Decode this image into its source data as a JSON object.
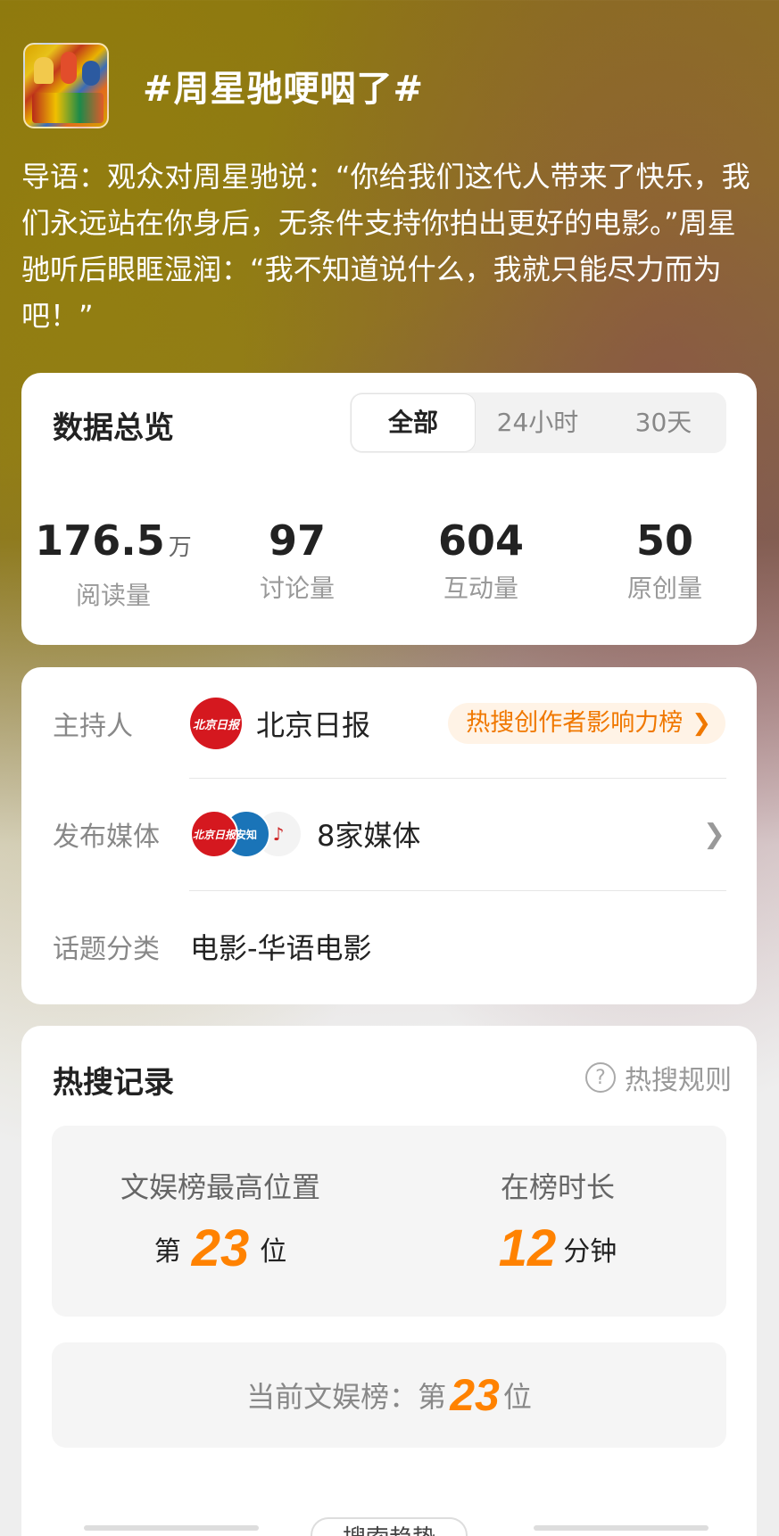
{
  "topic": {
    "title": "#周星驰哽咽了#",
    "intro": "导语：观众对周星驰说：“你给我们这代人带来了快乐，我们永远站在你身后，无条件支持你拍出更好的电影。”周星驰听后眼眶湿润：“我不知道说什么，我就只能尽力而为吧！”"
  },
  "overview": {
    "title": "数据总览",
    "tabs": [
      "全部",
      "24小时",
      "30天"
    ],
    "stats": [
      {
        "value": "176.5",
        "unit": "万",
        "label": "阅读量"
      },
      {
        "value": "97",
        "unit": "",
        "label": "讨论量"
      },
      {
        "value": "604",
        "unit": "",
        "label": "互动量"
      },
      {
        "value": "50",
        "unit": "",
        "label": "原创量"
      }
    ]
  },
  "host": {
    "host_label": "主持人",
    "host_name": "北京日报",
    "host_avatar_text": "北京日报",
    "rank_badge": "热搜创作者影响力榜",
    "media_label": "发布媒体",
    "media_count": "8家媒体",
    "category_label": "话题分类",
    "category_value": "电影-华语电影"
  },
  "hot_search": {
    "title": "热搜记录",
    "rules_label": "热搜规则",
    "peak_label": "文娱榜最高位置",
    "peak_prefix": "第",
    "peak_value": "23",
    "peak_suffix": "位",
    "duration_label": "在榜时长",
    "duration_value": "12",
    "duration_unit": "分钟",
    "current_prefix": "当前文娱榜：第",
    "current_value": "23",
    "current_suffix": "位",
    "bottom_tab": "搜索趋势"
  },
  "colors": {
    "accent_orange": "#ff8200",
    "badge_bg": "#fff3e6",
    "brand_red": "#d5181f"
  }
}
